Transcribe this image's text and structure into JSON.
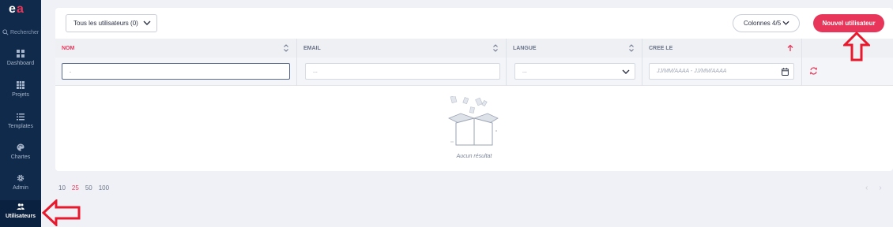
{
  "sidebar": {
    "search_label": "Rechercher",
    "items": [
      {
        "label": "Dashboard",
        "icon": "dashboard-icon"
      },
      {
        "label": "Projets",
        "icon": "projects-icon"
      },
      {
        "label": "Templates",
        "icon": "templates-icon"
      },
      {
        "label": "Chartes",
        "icon": "palette-icon"
      },
      {
        "label": "Admin",
        "icon": "gear-icon"
      },
      {
        "label": "Utilisateurs",
        "icon": "users-icon",
        "active": true
      }
    ]
  },
  "toolbar": {
    "user_filter": "Tous les utilisateurs (0)",
    "columns_button": "Colonnes 4/5",
    "new_user_button": "Nouvel utilisateur"
  },
  "table": {
    "columns": [
      "NOM",
      "EMAIL",
      "LANGUE",
      "CREE LE"
    ],
    "filters": {
      "nom_value": ".",
      "email_placeholder": "...",
      "langue_value": "...",
      "date_placeholder": "JJ/MM/AAAA - JJ/MM/AAAA"
    },
    "empty_text": "Aucun résultat"
  },
  "pagination": {
    "sizes": [
      "10",
      "25",
      "50",
      "100"
    ],
    "current": "25"
  },
  "colors": {
    "accent": "#e8365a",
    "sidebar": "#0f2a4a",
    "annotation": "#e8192c"
  }
}
